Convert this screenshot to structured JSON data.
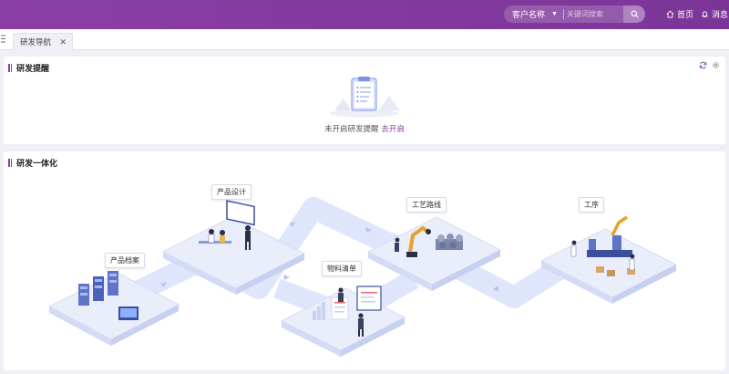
{
  "header": {
    "search_scope": "客户名称",
    "search_placeholder": "关键词搜索",
    "home_label": "首页",
    "messages_label": "消息",
    "brand_color": "#8a3fa6"
  },
  "tabs": [
    {
      "label": "研发导航",
      "active": true
    }
  ],
  "reminder": {
    "title": "研发提醒",
    "empty_text": "未开启研发提醒",
    "enable_link": "去开启"
  },
  "integration": {
    "title": "研发一体化",
    "stages": [
      "产品档案",
      "产品设计",
      "物料清单",
      "工艺路线",
      "工序"
    ]
  }
}
